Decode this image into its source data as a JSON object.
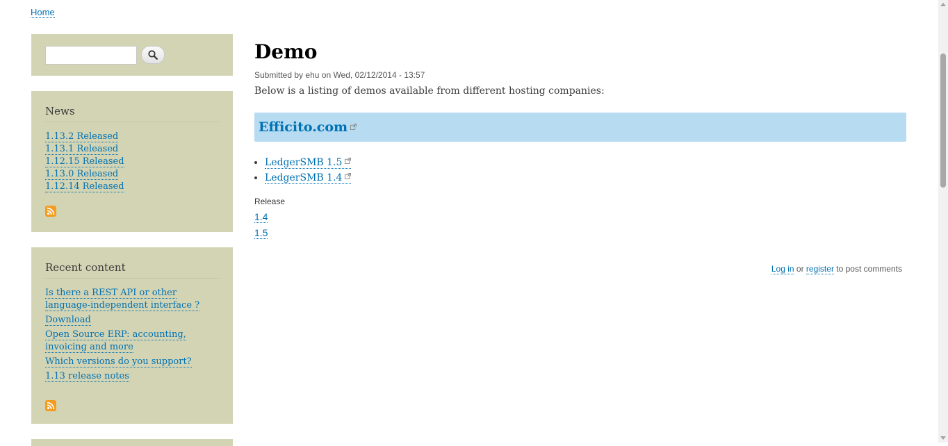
{
  "breadcrumb": {
    "home": "Home"
  },
  "search": {
    "placeholder": ""
  },
  "news": {
    "title": "News",
    "items": [
      "1.13.2 Released",
      "1.13.1 Released",
      "1.12.15 Released",
      "1.13.0 Released",
      "1.12.14 Released"
    ]
  },
  "recent": {
    "title": "Recent content",
    "items": [
      "Is there a REST API or other language-independent interface ?",
      "Download",
      "Open Source ERP: accounting, invoicing and more",
      "Which versions do you support?",
      "1.13 release notes"
    ]
  },
  "main": {
    "title": "Demo",
    "submitted_prefix": "Submitted by",
    "author": "ehu",
    "submitted_on": "on Wed, 02/12/2014 - 13:57",
    "intro": "Below is a listing of demos available from different hosting companies:",
    "provider": "Efficito.com",
    "demos": [
      "LedgerSMB 1.5",
      "LedgerSMB 1.4"
    ],
    "release_label": "Release",
    "releases": [
      "1.4",
      "1.5"
    ],
    "login": "Log in",
    "or": "or",
    "register": "register",
    "to_post": "to post comments"
  },
  "colors": {
    "sidebar_bg": "#d3d4b4",
    "link": "#0071b3",
    "provider_bg": "#b7dcf2",
    "feed": "#f39c1f"
  }
}
